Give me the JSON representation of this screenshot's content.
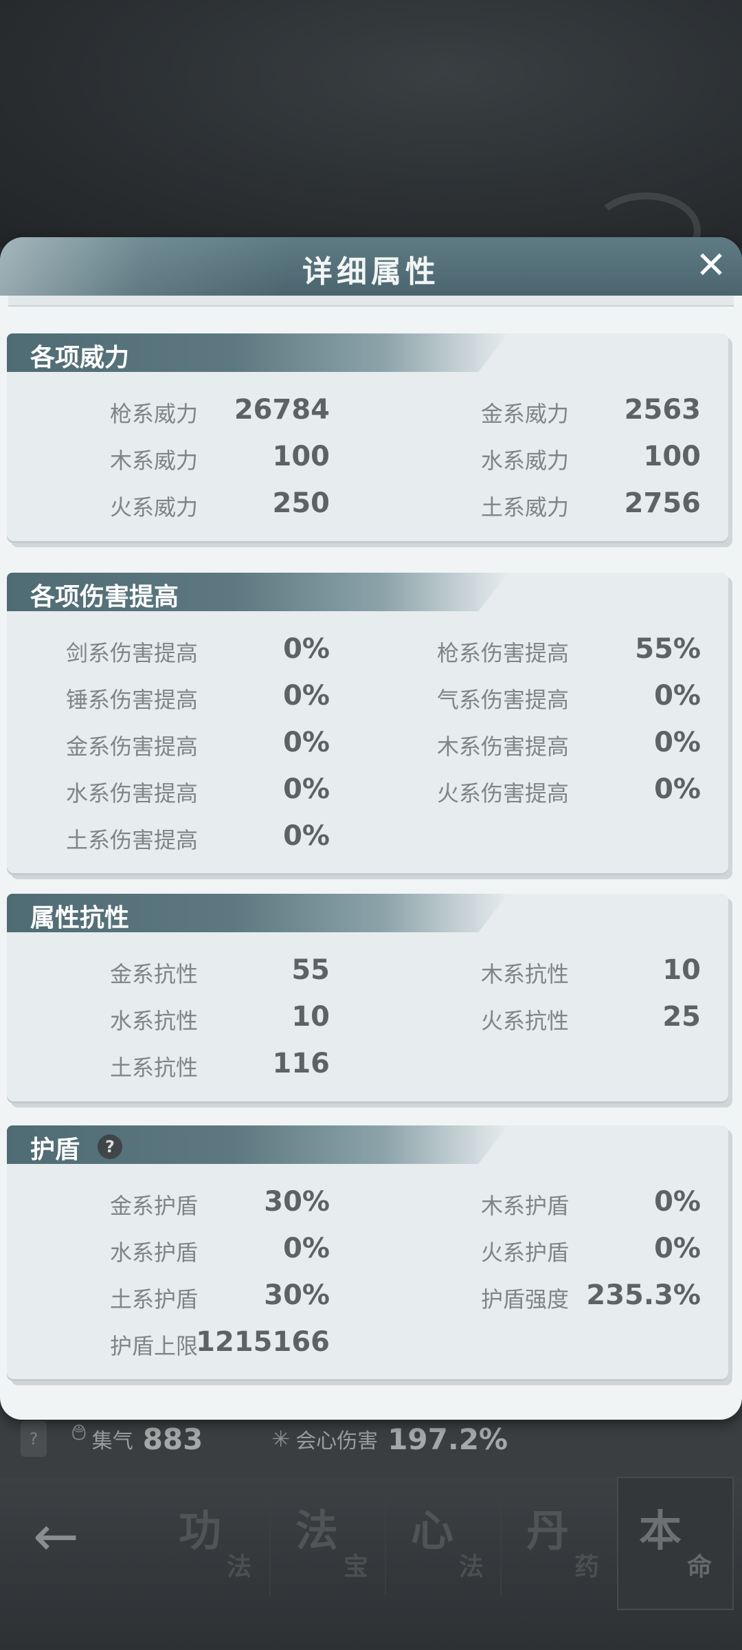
{
  "dialog": {
    "title": "详细属性",
    "close_icon": "close-icon"
  },
  "sections": [
    {
      "title": "各项威力",
      "rows": [
        {
          "left_label": "枪系威力",
          "left_value": "26784",
          "right_label": "金系威力",
          "right_value": "2563"
        },
        {
          "left_label": "木系威力",
          "left_value": "100",
          "right_label": "水系威力",
          "right_value": "100"
        },
        {
          "left_label": "火系威力",
          "left_value": "250",
          "right_label": "土系威力",
          "right_value": "2756"
        }
      ]
    },
    {
      "title": "各项伤害提高",
      "rows": [
        {
          "left_label": "剑系伤害提高",
          "left_value": "0%",
          "right_label": "枪系伤害提高",
          "right_value": "55%"
        },
        {
          "left_label": "锤系伤害提高",
          "left_value": "0%",
          "right_label": "气系伤害提高",
          "right_value": "0%"
        },
        {
          "left_label": "金系伤害提高",
          "left_value": "0%",
          "right_label": "木系伤害提高",
          "right_value": "0%"
        },
        {
          "left_label": "水系伤害提高",
          "left_value": "0%",
          "right_label": "火系伤害提高",
          "right_value": "0%"
        },
        {
          "left_label": "土系伤害提高",
          "left_value": "0%"
        }
      ]
    },
    {
      "title": "属性抗性",
      "rows": [
        {
          "left_label": "金系抗性",
          "left_value": "55",
          "right_label": "木系抗性",
          "right_value": "10"
        },
        {
          "left_label": "水系抗性",
          "left_value": "10",
          "right_label": "火系抗性",
          "right_value": "25"
        },
        {
          "left_label": "土系抗性",
          "left_value": "116"
        }
      ]
    },
    {
      "title": "护盾",
      "help": "?",
      "rows": [
        {
          "left_label": "金系护盾",
          "left_value": "30%",
          "right_label": "木系护盾",
          "right_value": "0%"
        },
        {
          "left_label": "水系护盾",
          "left_value": "0%",
          "right_label": "火系护盾",
          "right_value": "0%"
        },
        {
          "left_label": "土系护盾",
          "left_value": "30%",
          "right_label": "护盾强度",
          "right_value": "235.3%"
        },
        {
          "left_label": "护盾上限",
          "left_value": "1215166"
        }
      ]
    }
  ],
  "background_stats": {
    "help": "?",
    "qi_label": "集气",
    "qi_value": "883",
    "crit_label": "会心伤害",
    "crit_value": "197.2%"
  },
  "bottom_nav": {
    "back_icon": "back-arrow-icon",
    "tabs": [
      {
        "big": "功",
        "small": "法"
      },
      {
        "big": "法",
        "small": "宝"
      },
      {
        "big": "心",
        "small": "法"
      },
      {
        "big": "丹",
        "small": "药"
      },
      {
        "big": "本",
        "small": "命"
      }
    ]
  }
}
